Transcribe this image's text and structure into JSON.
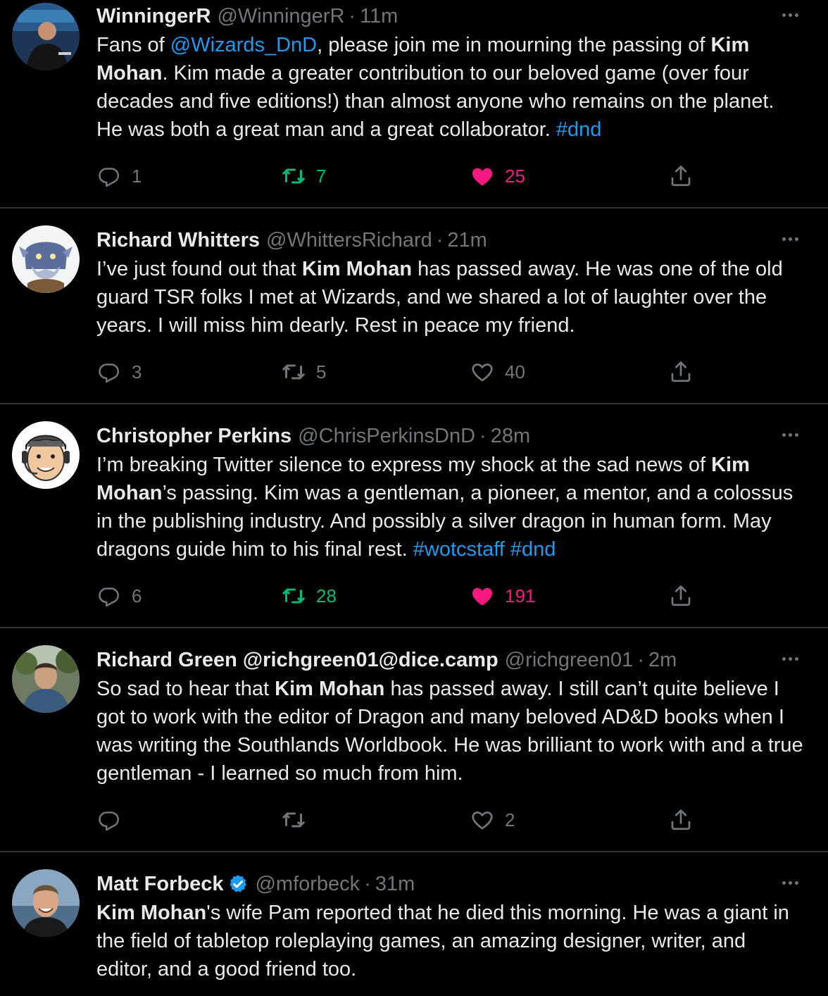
{
  "colors": {
    "background": "#000000",
    "text": "#e7e9ea",
    "muted": "#71767b",
    "link": "#1d9bf0",
    "retweet_active": "#00ba7c",
    "like_active": "#f91880",
    "divider": "#2f3336",
    "verified": "#1d9bf0"
  },
  "tweets": [
    {
      "name": "WinningerR",
      "handle": "@WinningerR",
      "separator": "·",
      "time": "11m",
      "avatar_icon": "user-photo-avatar",
      "text": [
        {
          "t": "Fans of "
        },
        {
          "t": "@Wizards_DnD",
          "link": true
        },
        {
          "t": ", please join me in mourning the passing of "
        },
        {
          "t": "Kim Mohan",
          "bold": true
        },
        {
          "t": ". Kim made a greater contribution to our beloved game (over four decades and five editions!) than almost anyone who remains on the planet. He was both a great man and a great collaborator. "
        },
        {
          "t": "#dnd",
          "link": true
        }
      ],
      "replies": "1",
      "retweets": "7",
      "likes": "25",
      "retweeted": true,
      "liked": true
    },
    {
      "name": "Richard Whitters",
      "handle": "@WhittersRichard",
      "separator": "·",
      "time": "21m",
      "avatar_icon": "creature-illustration-avatar",
      "text": [
        {
          "t": "I’ve just found out that "
        },
        {
          "t": "Kim Mohan",
          "bold": true
        },
        {
          "t": " has passed away. He was one of the old guard TSR folks I met at Wizards, and we shared a lot of laughter over the years. I will miss him dearly. Rest in peace my friend."
        }
      ],
      "replies": "3",
      "retweets": "5",
      "likes": "40",
      "retweeted": false,
      "liked": false
    },
    {
      "name": "Christopher Perkins",
      "handle": "@ChrisPerkinsDnD",
      "separator": "·",
      "time": "28m",
      "avatar_icon": "cartoon-headset-avatar",
      "text": [
        {
          "t": "I’m breaking Twitter silence to express my shock at the sad news of "
        },
        {
          "t": "Kim Mohan",
          "bold": true
        },
        {
          "t": "’s passing. Kim was a gentleman, a pioneer, a mentor, and a colossus in the publishing industry. And possibly a silver dragon in human form. May dragons guide him to his final rest. "
        },
        {
          "t": "#wotcstaff",
          "link": true
        },
        {
          "t": " "
        },
        {
          "t": "#dnd",
          "link": true
        }
      ],
      "replies": "6",
      "retweets": "28",
      "likes": "191",
      "retweeted": true,
      "liked": true
    },
    {
      "name": "Richard Green @richgreen01@dice.camp",
      "handle": "@richgreen01",
      "separator": "·",
      "time": "2m",
      "avatar_icon": "user-photo-avatar",
      "text": [
        {
          "t": "So sad to hear that "
        },
        {
          "t": "Kim Mohan",
          "bold": true
        },
        {
          "t": " has passed away. I still can’t quite believe I got to work with the editor of Dragon and many beloved AD&D books when I was writing the Southlands Worldbook. He was brilliant to work with and a true gentleman - I learned so much from him."
        }
      ],
      "replies": "",
      "retweets": "",
      "likes": "2",
      "retweeted": false,
      "liked": false
    },
    {
      "name": "Matt Forbeck",
      "handle": "@mforbeck",
      "separator": "·",
      "time": "31m",
      "verified": true,
      "avatar_icon": "user-photo-avatar",
      "text": [
        {
          "t": "Kim Mohan",
          "bold": true
        },
        {
          "t": "'s wife Pam reported that he died this morning. He was a giant in the field of tabletop roleplaying games, an amazing designer, writer, and editor, and a good friend too."
        }
      ]
    }
  ]
}
